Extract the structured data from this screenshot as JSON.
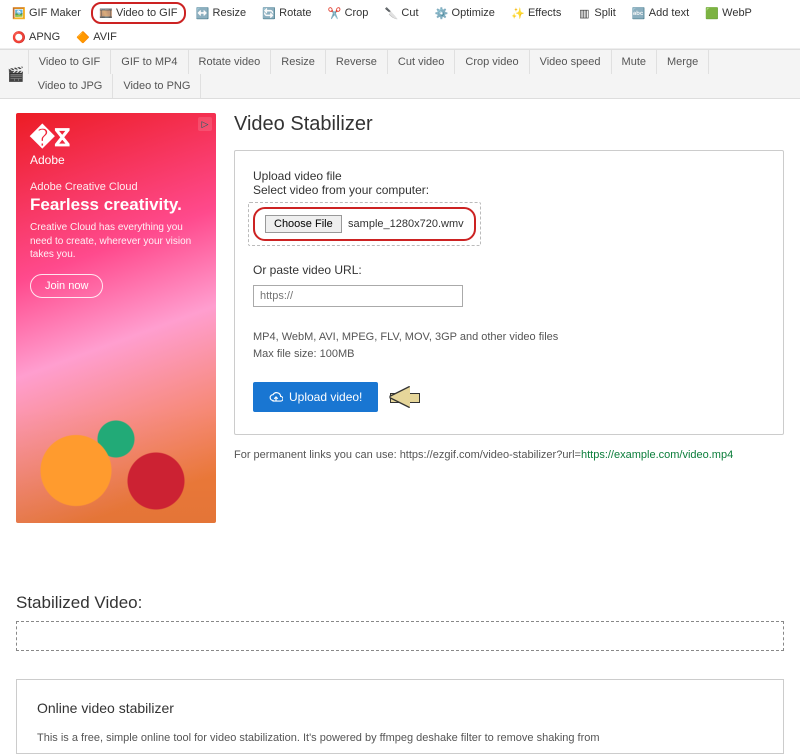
{
  "topnav": [
    {
      "label": "GIF Maker",
      "icon": "🖼️",
      "highlighted": false
    },
    {
      "label": "Video to GIF",
      "icon": "🎞️",
      "highlighted": true
    },
    {
      "label": "Resize",
      "icon": "↔️",
      "highlighted": false
    },
    {
      "label": "Rotate",
      "icon": "🔄",
      "highlighted": false
    },
    {
      "label": "Crop",
      "icon": "✂️",
      "highlighted": false
    },
    {
      "label": "Cut",
      "icon": "🔪",
      "highlighted": false
    },
    {
      "label": "Optimize",
      "icon": "⚙️",
      "highlighted": false
    },
    {
      "label": "Effects",
      "icon": "✨",
      "highlighted": false
    },
    {
      "label": "Split",
      "icon": "▥",
      "highlighted": false
    },
    {
      "label": "Add text",
      "icon": "🔤",
      "highlighted": false
    },
    {
      "label": "WebP",
      "icon": "🟩",
      "highlighted": false
    },
    {
      "label": "APNG",
      "icon": "⭕",
      "highlighted": false
    },
    {
      "label": "AVIF",
      "icon": "🔶",
      "highlighted": false
    }
  ],
  "subnav": [
    "Video to GIF",
    "GIF to MP4",
    "Rotate video",
    "Resize",
    "Reverse",
    "Cut video",
    "Crop video",
    "Video speed",
    "Mute",
    "Merge",
    "Video to JPG",
    "Video to PNG"
  ],
  "ad": {
    "brand": "Adobe",
    "tagline1": "Adobe Creative Cloud",
    "tagline2": "Fearless creativity.",
    "copy": "Creative Cloud has everything you need to create, wherever your vision takes you.",
    "cta": "Join now"
  },
  "page": {
    "title": "Video Stabilizer",
    "legend": "Upload video file",
    "select_label": "Select video from your computer:",
    "choose_btn": "Choose File",
    "filename": "sample_1280x720.wmv",
    "or_label": "Or paste video URL:",
    "url_placeholder": "https://",
    "hint1": "MP4, WebM, AVI, MPEG, FLV, MOV, 3GP and other video files",
    "hint2": "Max file size: 100MB",
    "upload_btn": "Upload video!",
    "permalink_text": "For permanent links you can use: https://ezgif.com/video-stabilizer?url=",
    "permalink_url": "https://example.com/video.mp4",
    "stabilized_heading": "Stabilized Video:",
    "info_heading": "Online video stabilizer",
    "info_body": "This is a free, simple online tool for video stabilization. It's powered by ffmpeg deshake filter to remove shaking from"
  }
}
